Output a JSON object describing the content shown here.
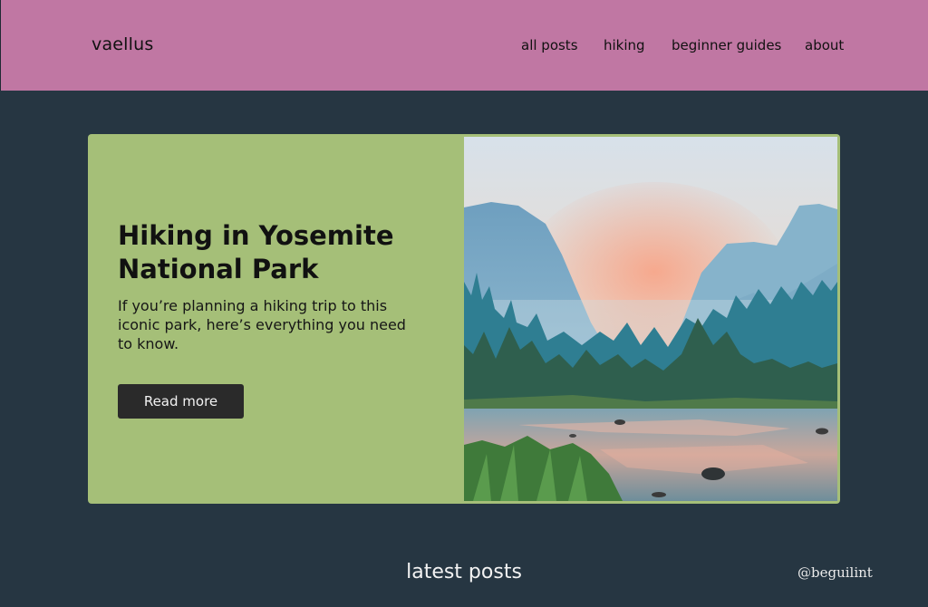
{
  "header": {
    "brand": "vaellus",
    "nav": [
      "all posts",
      "hiking",
      "beginner guides",
      "about"
    ]
  },
  "hero": {
    "title": "Hiking in Yosemite National Park",
    "description": "If you’re planning a hiking trip to this iconic park, here’s everything you need to know.",
    "button_label": "Read more",
    "image_alt": "Yosemite valley at sunrise with river and forest"
  },
  "section": {
    "heading": "latest posts"
  },
  "credit": "@beguilint",
  "colors": {
    "header_bg": "#c077a3",
    "page_bg": "#263642",
    "card_bg": "#a5bf78",
    "button_bg": "#2a2a2a"
  }
}
